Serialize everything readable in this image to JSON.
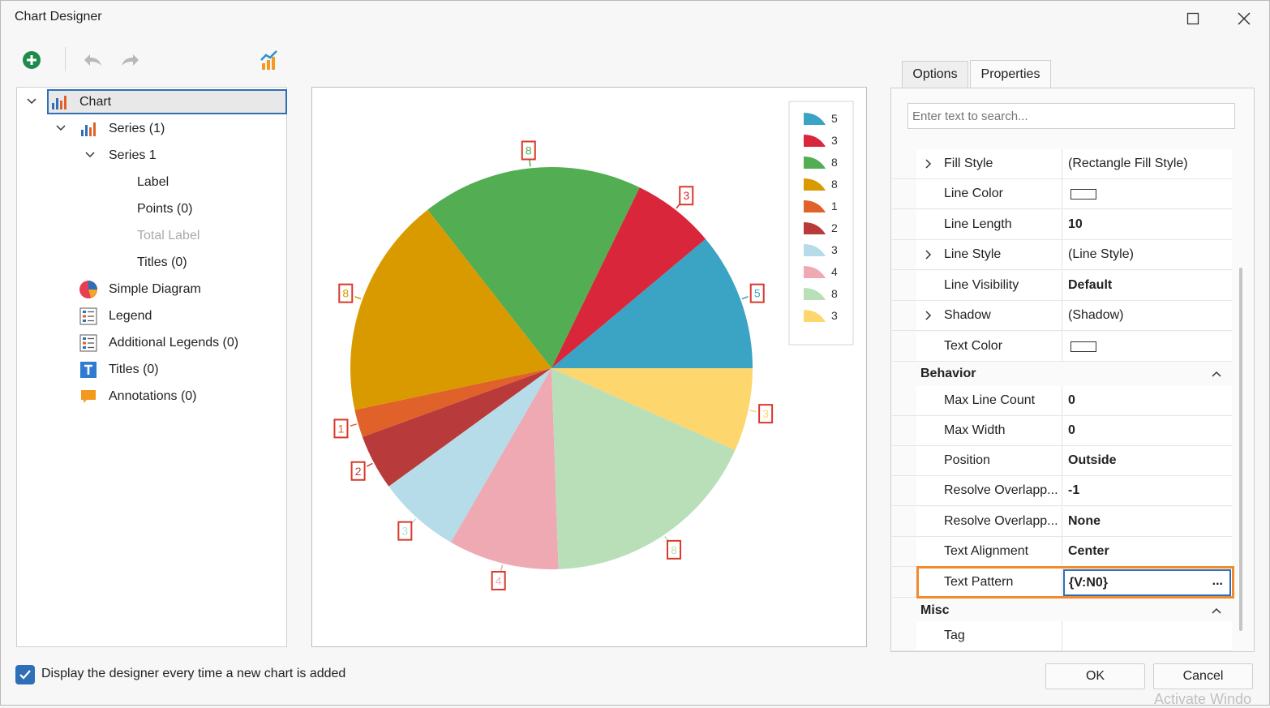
{
  "window": {
    "title": "Chart Designer"
  },
  "toolbar": {
    "add": "add-icon",
    "undo": "undo-icon",
    "redo": "redo-icon",
    "chart_wizard": "chart-wizard-icon"
  },
  "tree": {
    "chart": "Chart",
    "series_group": "Series (1)",
    "series1": "Series 1",
    "label": "Label",
    "points": "Points (0)",
    "total_label": "Total Label",
    "titles_series": "Titles (0)",
    "simple_diagram": "Simple Diagram",
    "legend": "Legend",
    "additional_legends": "Additional Legends (0)",
    "titles": "Titles (0)",
    "annotations": "Annotations (0)"
  },
  "chart_data": {
    "type": "pie",
    "values": [
      5,
      3,
      8,
      8,
      1,
      2,
      3,
      4,
      8,
      3
    ],
    "labels": [
      "5",
      "3",
      "8",
      "8",
      "1",
      "2",
      "3",
      "4",
      "8",
      "3"
    ],
    "colors": [
      "#3ba3c3",
      "#d9263a",
      "#53ad52",
      "#d99a00",
      "#e0622a",
      "#b93a3a",
      "#b5dce8",
      "#efa9b3",
      "#b9dfb8",
      "#fed66e"
    ],
    "legend": [
      "5",
      "3",
      "8",
      "8",
      "1",
      "2",
      "3",
      "4",
      "8",
      "3"
    ],
    "legend_position": "top-right"
  },
  "tabs": [
    "Options",
    "Properties"
  ],
  "search": {
    "placeholder": "Enter text to search..."
  },
  "properties": {
    "fill_style": {
      "name": "Fill Style",
      "value": "(Rectangle Fill Style)"
    },
    "line_color": {
      "name": "Line Color",
      "value": "#ffffff"
    },
    "line_length": {
      "name": "Line Length",
      "value": "10"
    },
    "line_style": {
      "name": "Line Style",
      "value": "(Line Style)"
    },
    "line_visibility": {
      "name": "Line Visibility",
      "value": "Default"
    },
    "shadow": {
      "name": "Shadow",
      "value": "(Shadow)"
    },
    "text_color": {
      "name": "Text Color",
      "value": "#ffffff"
    },
    "behavior": "Behavior",
    "max_line_count": {
      "name": "Max Line Count",
      "value": "0"
    },
    "max_width": {
      "name": "Max Width",
      "value": "0"
    },
    "position": {
      "name": "Position",
      "value": "Outside"
    },
    "resolve1": {
      "name": "Resolve Overlapp...",
      "value": "-1"
    },
    "resolve2": {
      "name": "Resolve Overlapp...",
      "value": "None"
    },
    "text_alignment": {
      "name": "Text Alignment",
      "value": "Center"
    },
    "text_pattern": {
      "name": "Text Pattern",
      "value": "{V:N0}",
      "ellipsis": "..."
    },
    "misc": "Misc",
    "tag": {
      "name": "Tag",
      "value": ""
    }
  },
  "footer": {
    "checkbox_label": "Display the designer every time a new chart is added",
    "checked": true,
    "ok": "OK",
    "cancel": "Cancel",
    "watermark": "Activate Windo"
  }
}
